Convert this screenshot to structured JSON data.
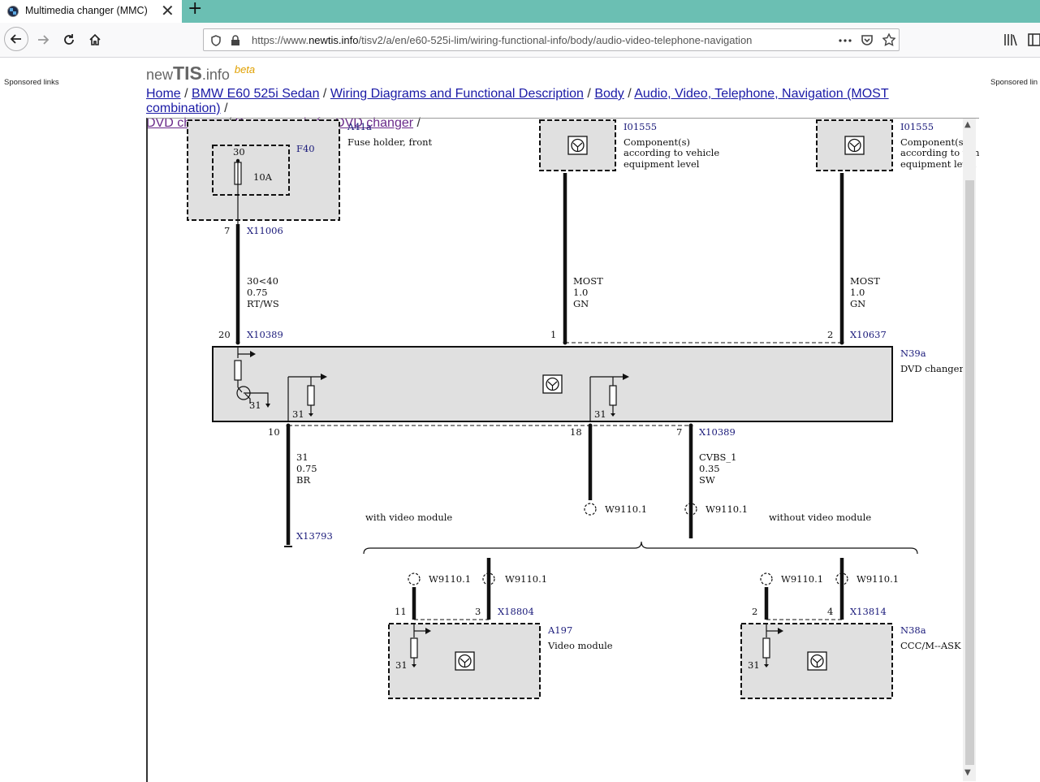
{
  "browser": {
    "tab_title": "Multimedia changer (MMC)",
    "tab_close": "✕",
    "new_tab": "+",
    "url_prefix": "https://www.",
    "url_domain": "newtis.info",
    "url_path": "/tisv2/a/en/e60-525i-lim/wiring-functional-info/body/audio-video-telephone-navigation"
  },
  "page": {
    "sponsored_left": "Sponsored links",
    "sponsored_right": "Sponsored lin",
    "logo": {
      "part1": "new",
      "part2": "TIS",
      "part3": ".info",
      "beta": "beta"
    },
    "breadcrumb": [
      "Home",
      "BMW E60 525i Sedan",
      "Wiring Diagrams and Functional Description",
      "Body",
      "Audio, Video, Telephone, Navigation (MOST combination)",
      "DVD changer",
      "Power supply for DVD changer"
    ],
    "separator": "/"
  },
  "diagram": {
    "fuse_holder": {
      "id": "A41a",
      "name": "Fuse holder, front",
      "fuse": "F40",
      "terminal": "30",
      "rating": "10A"
    },
    "component_left": {
      "id": "I01555",
      "desc": [
        "Component(s)",
        "according to vehicle",
        "equipment level"
      ]
    },
    "component_right": {
      "id": "I01555",
      "desc": [
        "Component(s)",
        "according to vehi",
        "equipment level"
      ]
    },
    "connectors": {
      "x11006": "X11006",
      "x10389": "X10389",
      "x10637": "X10637",
      "x13793": "X13793",
      "x18804": "X18804",
      "x13814": "X13814"
    },
    "pins": {
      "p7a": "7",
      "p20": "20",
      "p1": "1",
      "p2": "2",
      "p10": "10",
      "p18": "18",
      "p7b": "7",
      "p11": "11",
      "p3": "3",
      "p2b": "2",
      "p4": "4"
    },
    "wire_supply": [
      "30<40",
      "0.75",
      "RT/WS"
    ],
    "wire_most_left": [
      "MOST",
      "1.0",
      "GN"
    ],
    "wire_most_right": [
      "MOST",
      "1.0",
      "GN"
    ],
    "wire_ground": [
      "31",
      "0.75",
      "BR"
    ],
    "wire_cvbs": [
      "CVBS_1",
      "0.35",
      "SW"
    ],
    "dvd_changer": {
      "id": "N39a",
      "name": "DVD changer"
    },
    "ground_label": "31",
    "splice": "W9110.1",
    "with_video": "with video module",
    "without_video": "without video module",
    "video_module": {
      "id": "A197",
      "name": "Video module"
    },
    "ccc_module": {
      "id": "N38a",
      "name": "CCC/M--ASK"
    }
  }
}
